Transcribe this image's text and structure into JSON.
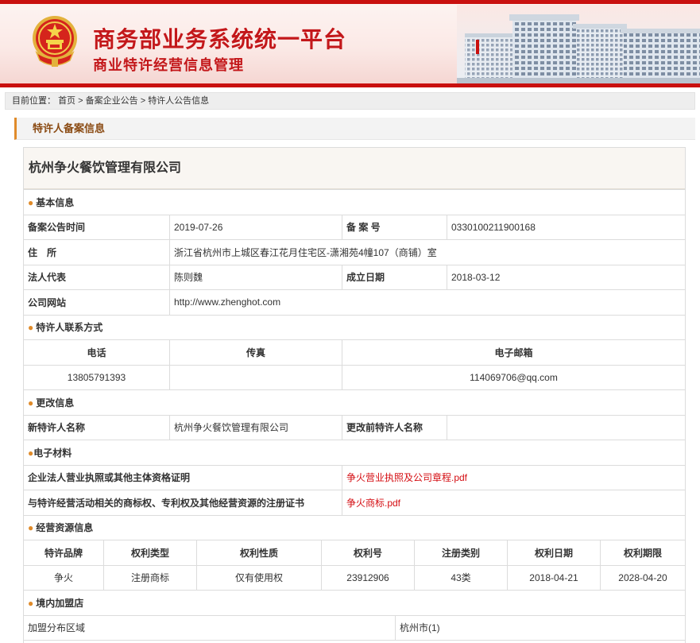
{
  "header": {
    "title": "商务部业务系统统一平台",
    "subtitle": "商业特许经营信息管理",
    "emblem": "national-emblem-icon",
    "colors": {
      "brand_red": "#c3171a",
      "accent_orange": "#e08b2a",
      "link_red": "#d40d12"
    }
  },
  "breadcrumb": {
    "prefix": "目前位置：",
    "items": [
      "首页",
      "备案企业公告",
      "特许人公告信息"
    ],
    "separator": ">"
  },
  "section_title": "特许人备案信息",
  "company_name": "杭州争火餐饮管理有限公司",
  "basic": {
    "heading": "基本信息",
    "filing_date_label": "备案公告时间",
    "filing_date": "2019-07-26",
    "record_no_label": "备 案 号",
    "record_no": "0330100211900168",
    "address_label": "住　所",
    "address": "浙江省杭州市上城区春江花月住宅区-潇湘苑4幢107（商铺）室",
    "legal_rep_label": "法人代表",
    "legal_rep": "陈则魏",
    "founded_label": "成立日期",
    "founded": "2018-03-12",
    "website_label": "公司网站",
    "website": "http://www.zhenghot.com"
  },
  "contact": {
    "heading": "特许人联系方式",
    "phone_label": "电话",
    "fax_label": "传真",
    "email_label": "电子邮箱",
    "phone": "13805791393",
    "fax": "",
    "email": "114069706@qq.com"
  },
  "change": {
    "heading": "更改信息",
    "new_name_label": "新特许人名称",
    "new_name": "杭州争火餐饮管理有限公司",
    "old_name_label": "更改前特许人名称",
    "old_name": ""
  },
  "materials": {
    "heading": "电子材料",
    "items": [
      {
        "label": "企业法人营业执照或其他主体资格证明",
        "file": "争火营业执照及公司章程.pdf"
      },
      {
        "label": "与特许经营活动相关的商标权、专利权及其他经营资源的注册证书",
        "file": "争火商标.pdf"
      }
    ]
  },
  "resources": {
    "heading": "经营资源信息",
    "columns": [
      "特许品牌",
      "权利类型",
      "权利性质",
      "权利号",
      "注册类别",
      "权利日期",
      "权利期限"
    ],
    "rows": [
      [
        "争火",
        "注册商标",
        "仅有使用权",
        "23912906",
        "43类",
        "2018-04-21",
        "2028-04-20"
      ]
    ]
  },
  "stores": {
    "heading": "境内加盟店",
    "area_label": "加盟分布区域",
    "area": "杭州市(1)"
  }
}
